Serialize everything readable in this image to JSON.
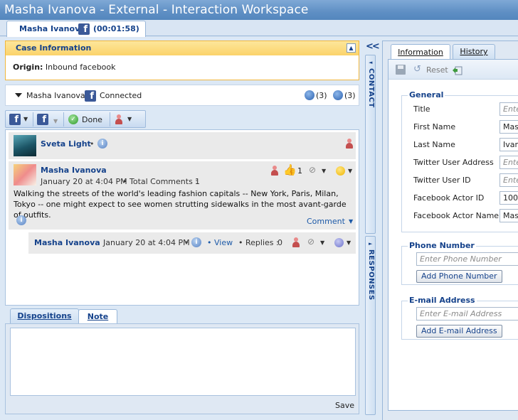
{
  "window": {
    "title": "Masha Ivanova - External - Interaction Workspace"
  },
  "session_tab": {
    "name": "Masha Ivanova",
    "channel_icon": "facebook-icon",
    "timer": "(00:01:58)"
  },
  "case_info": {
    "header": "Case Information",
    "origin_label": "Origin:",
    "origin_value": "Inbound facebook"
  },
  "contact_bar": {
    "name": "Masha Ivanova",
    "status": "Connected",
    "count1": "(3)",
    "count2": "(3)"
  },
  "toolbar": {
    "done_label": "Done"
  },
  "feed": {
    "post1": {
      "author": "Sveta Light",
      "sep": "•"
    },
    "post2": {
      "author": "Masha Ivanova",
      "date": "January 20 at 4:04 PM",
      "comments_label": "• Total Comments :",
      "comments_count": "1",
      "likes": "1",
      "text": "Walking the streets of the world's leading fashion capitals -- New York, Paris, Milan, Tokyo -- one might expect to see women strutting sidewalks in the most avant-garde of outfits.",
      "comment_link": "Comment"
    },
    "post3": {
      "author": "Masha Ivanova",
      "date": "January 20 at 4:04 PM",
      "sep": "•",
      "view_link": "• View",
      "replies_label": "• Replies :",
      "replies_count": "0"
    }
  },
  "bottom_tabs": {
    "dispositions": "Dispositions",
    "note": "Note"
  },
  "note": {
    "save": "Save"
  },
  "side_tabs": {
    "contact": "CONTACT",
    "responses": "RESPONSES"
  },
  "right_panel": {
    "tabs": {
      "information": "Information",
      "history": "History"
    },
    "toolbar": {
      "reset": "Reset"
    },
    "general": {
      "title": "General",
      "fields": [
        {
          "label": "Title",
          "value": "Ente",
          "placeholder": true
        },
        {
          "label": "First Name",
          "value": "Mash",
          "placeholder": false
        },
        {
          "label": "Last Name",
          "value": "Ivano",
          "placeholder": false
        },
        {
          "label": "Twitter User Address",
          "value": "Ente",
          "placeholder": true
        },
        {
          "label": "Twitter User ID",
          "value": "Ente",
          "placeholder": true
        },
        {
          "label": "Facebook Actor ID",
          "value": "1000",
          "placeholder": false
        },
        {
          "label": "Facebook Actor Name",
          "value": "Mash",
          "placeholder": false
        }
      ]
    },
    "phone": {
      "title": "Phone Number",
      "placeholder": "Enter Phone Number",
      "add_button": "Add Phone Number"
    },
    "email": {
      "title": "E-mail Address",
      "placeholder": "Enter E-mail Address",
      "add_button": "Add E-mail Address"
    }
  },
  "colors": {
    "accent": "#15428b",
    "case_header": "#fbd36a",
    "facebook": "#3b5998"
  }
}
